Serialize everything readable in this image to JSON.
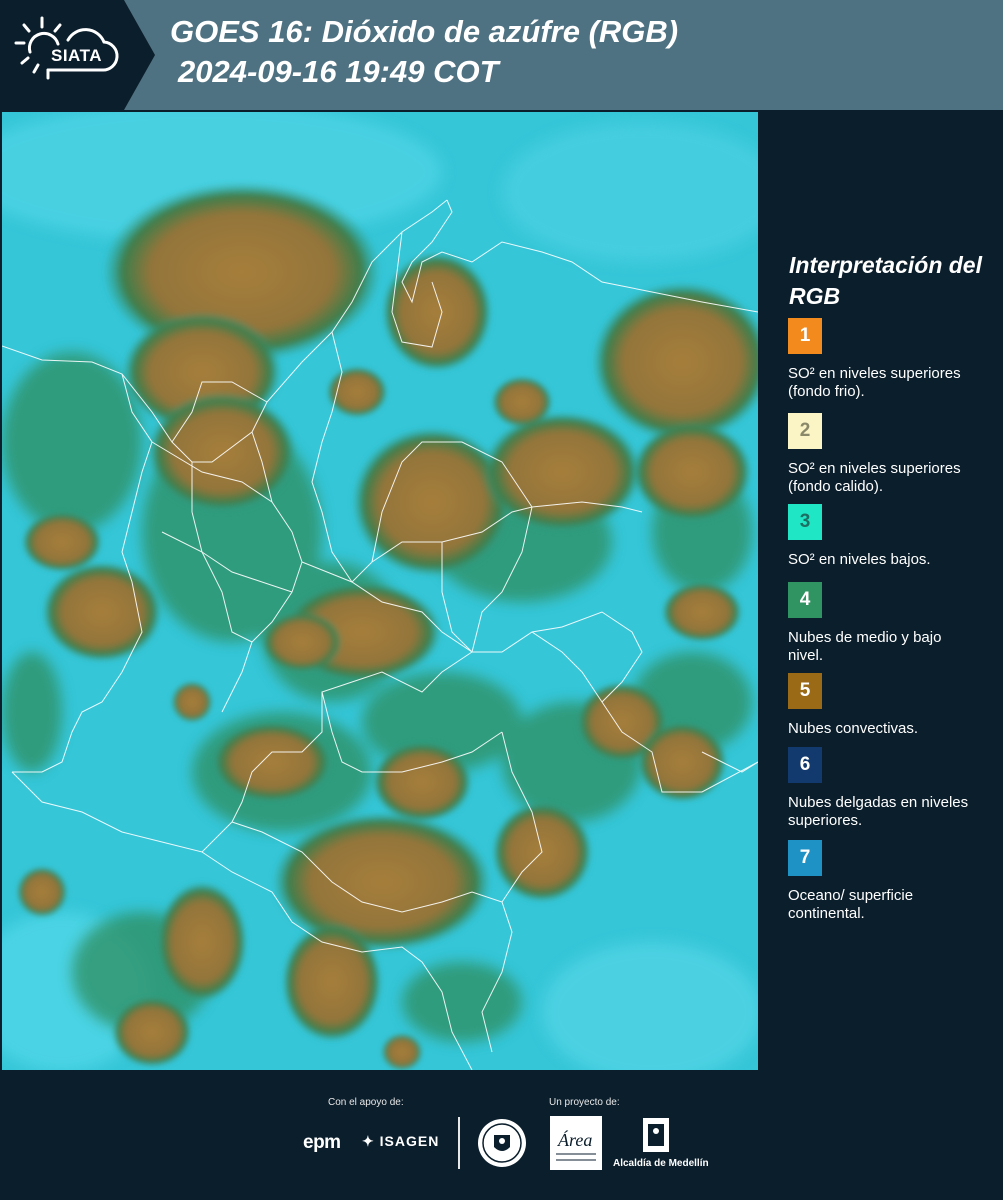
{
  "header": {
    "logo_text": "SIATA",
    "title_line1": "GOES 16: Dióxido de azúfre (RGB)",
    "title_line2": "2024-09-16 19:49 COT"
  },
  "map": {
    "image": "satellite-rgb-sulfur-dioxide-colombia",
    "colors": {
      "ocean": "#31c9dc",
      "low_cloud": "#2f8f5a",
      "convective": "#9a7a3a",
      "border": "#ffffff"
    }
  },
  "legend": {
    "title": "Interpretación del RGB",
    "items": [
      {
        "number": "1",
        "color": "#f28a1d",
        "label": "SO² en niveles superiores (fondo frio)."
      },
      {
        "number": "2",
        "color": "#fbf5c6",
        "label": "SO² en niveles superiores (fondo calido)."
      },
      {
        "number": "3",
        "color": "#1fe6c4",
        "label": "SO² en niveles bajos."
      },
      {
        "number": "4",
        "color": "#2f9461",
        "label": "Nubes de medio y bajo nivel."
      },
      {
        "number": "5",
        "color": "#9a6a16",
        "label": "Nubes convectivas."
      },
      {
        "number": "6",
        "color": "#123a6e",
        "label": "Nubes delgadas en niveles superiores."
      },
      {
        "number": "7",
        "color": "#1e92c4",
        "label": "Oceano/ superficie continental."
      }
    ]
  },
  "footer": {
    "support_label": "Con el apoyo de:",
    "project_label": "Un proyecto de:",
    "epm": "epm",
    "isagen": "ISAGEN",
    "amva_text": "Área",
    "medellin_text": "Alcaldía de Medellín"
  }
}
